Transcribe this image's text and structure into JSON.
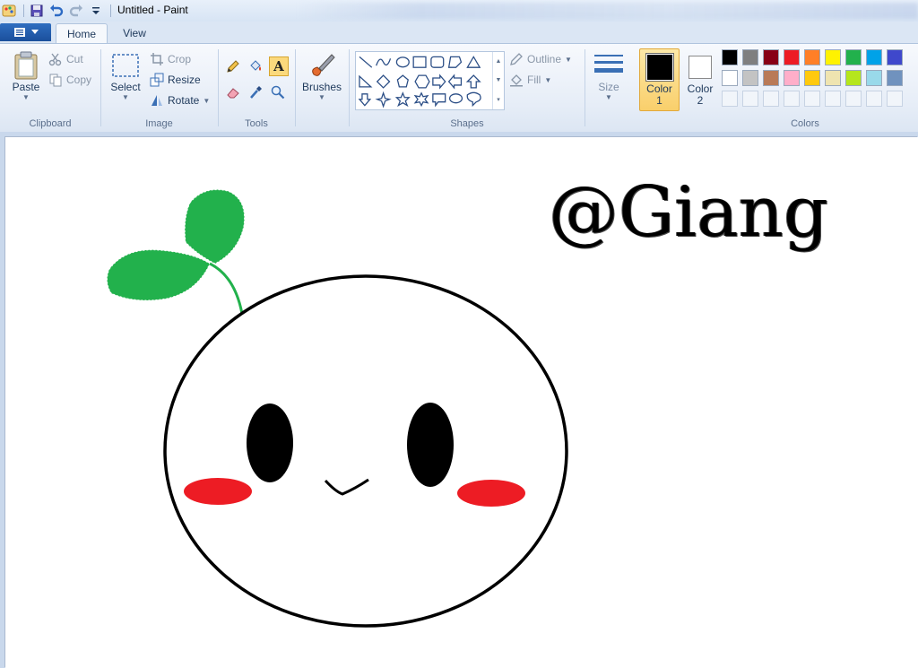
{
  "window": {
    "title": "Untitled - Paint"
  },
  "tabs": [
    {
      "label": "Home",
      "active": true
    },
    {
      "label": "View",
      "active": false
    }
  ],
  "ribbon": {
    "clipboard": {
      "label": "Clipboard",
      "paste": "Paste",
      "cut": "Cut",
      "copy": "Copy"
    },
    "image": {
      "label": "Image",
      "select": "Select",
      "crop": "Crop",
      "resize": "Resize",
      "rotate": "Rotate"
    },
    "tools": {
      "label": "Tools"
    },
    "brushes": {
      "label": "Brushes"
    },
    "shapes": {
      "label": "Shapes",
      "outline": "Outline",
      "fill": "Fill"
    },
    "size": {
      "label": "Size"
    },
    "color1": {
      "label": "Color",
      "num": "1",
      "value": "#000000"
    },
    "color2": {
      "label": "Color",
      "num": "2",
      "value": "#ffffff"
    },
    "colors": {
      "label": "Colors",
      "row1": [
        "#000000",
        "#7f7f7f",
        "#880015",
        "#ed1c24",
        "#ff7f27",
        "#fff200",
        "#22b14c",
        "#00a2e8",
        "#3f48cc",
        "#a349a4"
      ],
      "row2": [
        "#ffffff",
        "#c3c3c3",
        "#b97a57",
        "#ffaec9",
        "#ffc90e",
        "#efe4b0",
        "#b5e61d",
        "#99d9ea",
        "#7092be",
        "#c8bfe7"
      ]
    }
  },
  "canvas": {
    "text": "@Giang",
    "colors": {
      "leaf": "#22b14c",
      "blush": "#ed1c24",
      "stroke": "#000000"
    }
  }
}
